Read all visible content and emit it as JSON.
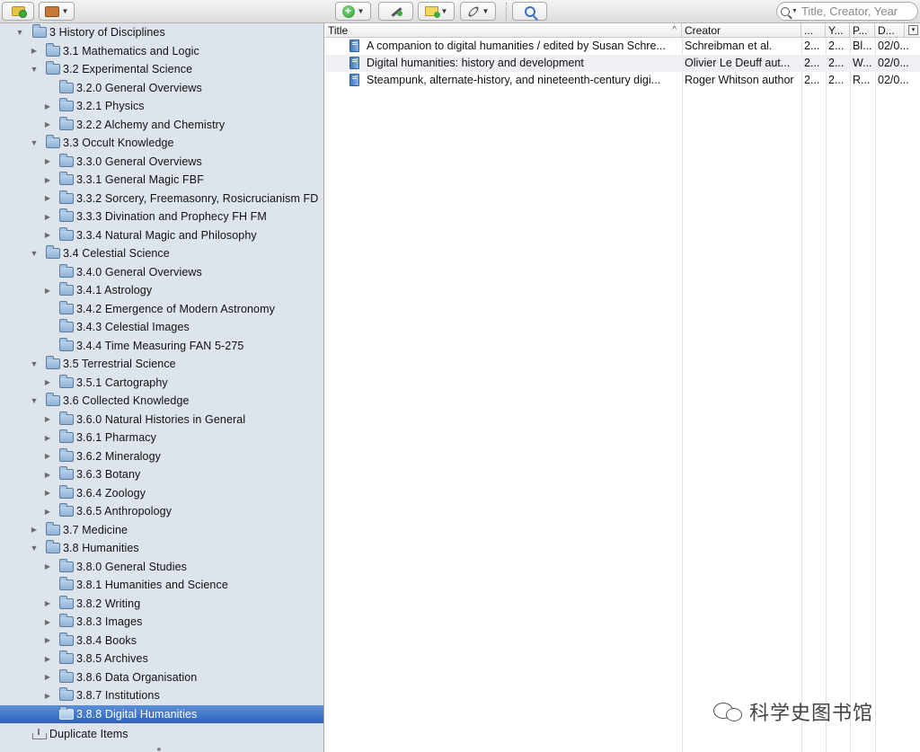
{
  "toolbar": {
    "new_collection_icon": "folder-plus-icon",
    "new_library_icon": "library-icon",
    "new_item_icon": "plus-icon",
    "add_by_identifier_icon": "magic-wand-icon",
    "new_note_icon": "note-plus-icon",
    "attachment_icon": "paperclip-icon",
    "advanced_search_icon": "magnifier-icon"
  },
  "search": {
    "placeholder": "Title, Creator, Year"
  },
  "collections": [
    {
      "label": "3 History of Disciplines",
      "level": 0,
      "toggle": "down"
    },
    {
      "label": "3.1 Mathematics and Logic",
      "level": 1,
      "toggle": "right"
    },
    {
      "label": "3.2 Experimental Science",
      "level": 1,
      "toggle": "down"
    },
    {
      "label": "3.2.0 General Overviews",
      "level": 2,
      "toggle": "none"
    },
    {
      "label": "3.2.1 Physics",
      "level": 2,
      "toggle": "right"
    },
    {
      "label": "3.2.2 Alchemy and Chemistry",
      "level": 2,
      "toggle": "right"
    },
    {
      "label": "3.3 Occult Knowledge",
      "level": 1,
      "toggle": "down"
    },
    {
      "label": "3.3.0 General Overviews",
      "level": 2,
      "toggle": "right"
    },
    {
      "label": "3.3.1 General Magic FBF",
      "level": 2,
      "toggle": "right"
    },
    {
      "label": "3.3.2 Sorcery, Freemasonry, Rosicrucianism FD",
      "level": 2,
      "toggle": "right"
    },
    {
      "label": "3.3.3 Divination and Prophecy FH FM",
      "level": 2,
      "toggle": "right"
    },
    {
      "label": "3.3.4 Natural Magic and Philosophy",
      "level": 2,
      "toggle": "right"
    },
    {
      "label": "3.4 Celestial Science",
      "level": 1,
      "toggle": "down"
    },
    {
      "label": "3.4.0 General Overviews",
      "level": 2,
      "toggle": "none"
    },
    {
      "label": "3.4.1 Astrology",
      "level": 2,
      "toggle": "right"
    },
    {
      "label": "3.4.2 Emergence of Modern Astronomy",
      "level": 2,
      "toggle": "none"
    },
    {
      "label": "3.4.3 Celestial Images",
      "level": 2,
      "toggle": "none"
    },
    {
      "label": "3.4.4 Time Measuring FAN 5-275",
      "level": 2,
      "toggle": "none"
    },
    {
      "label": "3.5 Terrestrial Science",
      "level": 1,
      "toggle": "down"
    },
    {
      "label": "3.5.1 Cartography",
      "level": 2,
      "toggle": "right"
    },
    {
      "label": "3.6 Collected Knowledge",
      "level": 1,
      "toggle": "down"
    },
    {
      "label": "3.6.0 Natural Histories in General",
      "level": 2,
      "toggle": "right"
    },
    {
      "label": "3.6.1 Pharmacy",
      "level": 2,
      "toggle": "right"
    },
    {
      "label": "3.6.2 Mineralogy",
      "level": 2,
      "toggle": "right"
    },
    {
      "label": "3.6.3 Botany",
      "level": 2,
      "toggle": "right"
    },
    {
      "label": "3.6.4 Zoology",
      "level": 2,
      "toggle": "right"
    },
    {
      "label": "3.6.5 Anthropology",
      "level": 2,
      "toggle": "right"
    },
    {
      "label": "3.7 Medicine",
      "level": 1,
      "toggle": "right"
    },
    {
      "label": "3.8 Humanities",
      "level": 1,
      "toggle": "down"
    },
    {
      "label": "3.8.0 General Studies",
      "level": 2,
      "toggle": "right"
    },
    {
      "label": "3.8.1 Humanities and Science",
      "level": 2,
      "toggle": "none"
    },
    {
      "label": "3.8.2 Writing",
      "level": 2,
      "toggle": "right"
    },
    {
      "label": "3.8.3 Images",
      "level": 2,
      "toggle": "right"
    },
    {
      "label": "3.8.4 Books",
      "level": 2,
      "toggle": "right"
    },
    {
      "label": "3.8.5 Archives",
      "level": 2,
      "toggle": "right"
    },
    {
      "label": "3.8.6 Data Organisation",
      "level": 2,
      "toggle": "right"
    },
    {
      "label": "3.8.7 Institutions",
      "level": 2,
      "toggle": "right"
    },
    {
      "label": "3.8.8 Digital Humanities",
      "level": 2,
      "toggle": "none",
      "selected": true
    }
  ],
  "duplicate_items_label": "Duplicate Items",
  "table": {
    "columns": [
      "Title",
      "Creator",
      "...",
      "Y...",
      "P...",
      "D..."
    ],
    "sort_indicator": "^",
    "column_picker_icon": "column-picker-icon",
    "rows": [
      {
        "title": "A companion to digital humanities / edited by Susan Schre...",
        "creator": "Schreibman et al.",
        "c3": "2...",
        "year": "2...",
        "publisher": "Bl...",
        "date": "02/0..."
      },
      {
        "title": "Digital humanities: history and development",
        "creator": "Olivier Le Deuff aut...",
        "c3": "2...",
        "year": "2...",
        "publisher": "W...",
        "date": "02/0..."
      },
      {
        "title": "Steampunk, alternate-history, and nineteenth-century digi...",
        "creator": "Roger Whitson author",
        "c3": "2...",
        "year": "2...",
        "publisher": "R...",
        "date": "02/0..."
      }
    ]
  },
  "watermark": {
    "text": "科学史图书馆",
    "icon": "wechat-icon"
  }
}
